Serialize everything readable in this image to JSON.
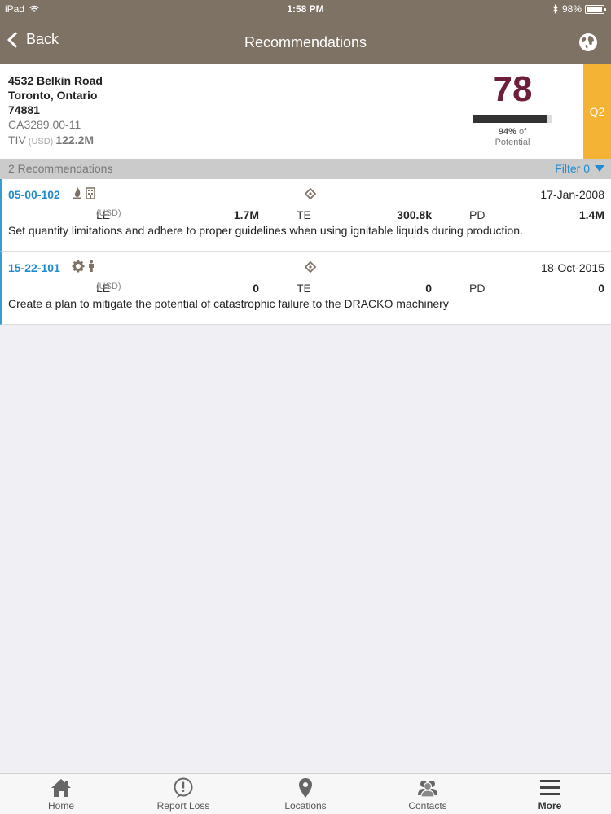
{
  "status_bar": {
    "device": "iPad",
    "time": "1:58 PM",
    "battery": "98%"
  },
  "nav": {
    "back_label": "Back",
    "title": "Recommendations"
  },
  "location": {
    "address_line1": "4532 Belkin Road",
    "address_line2": "Toronto, Ontario",
    "postal": "74881",
    "code": "CA3289.00-11",
    "tiv_label": "TIV",
    "tiv_currency": "(USD)",
    "tiv_value": "122.2M",
    "score": "78",
    "potential_percent_value": 94,
    "potential_percent": "94%",
    "potential_of": "of",
    "potential_label": "Potential",
    "quarter": "Q2"
  },
  "section": {
    "count_label": "2 Recommendations",
    "filter_label": "Filter 0"
  },
  "recommendations": [
    {
      "id": "05-00-102",
      "icons": [
        "fire-icon",
        "building-icon"
      ],
      "date": "17-Jan-2008",
      "le_label": "LE",
      "le_currency": "(USD)",
      "le_value": "1.7M",
      "te_label": "TE",
      "te_value": "300.8k",
      "pd_label": "PD",
      "pd_value": "1.4M",
      "description": "Set quantity limitations and adhere to proper guidelines when using ignitable liquids during production."
    },
    {
      "id": "15-22-101",
      "icons": [
        "gear-icon",
        "person-icon"
      ],
      "date": "18-Oct-2015",
      "le_label": "LE",
      "le_currency": "(USD)",
      "le_value": "0",
      "te_label": "TE",
      "te_value": "0",
      "pd_label": "PD",
      "pd_value": "0",
      "description": "Create a plan to mitigate the potential of catastrophic failure to the DRACKO machinery"
    }
  ],
  "tabs": [
    {
      "label": "Home",
      "icon": "home-icon"
    },
    {
      "label": "Report Loss",
      "icon": "alert-icon"
    },
    {
      "label": "Locations",
      "icon": "location-pin-icon"
    },
    {
      "label": "Contacts",
      "icon": "contacts-icon"
    },
    {
      "label": "More",
      "icon": "menu-icon"
    }
  ],
  "colors": {
    "header": "#7d7264",
    "score": "#6d1e3b",
    "quarter": "#f4b334",
    "link": "#1f8ccf"
  }
}
